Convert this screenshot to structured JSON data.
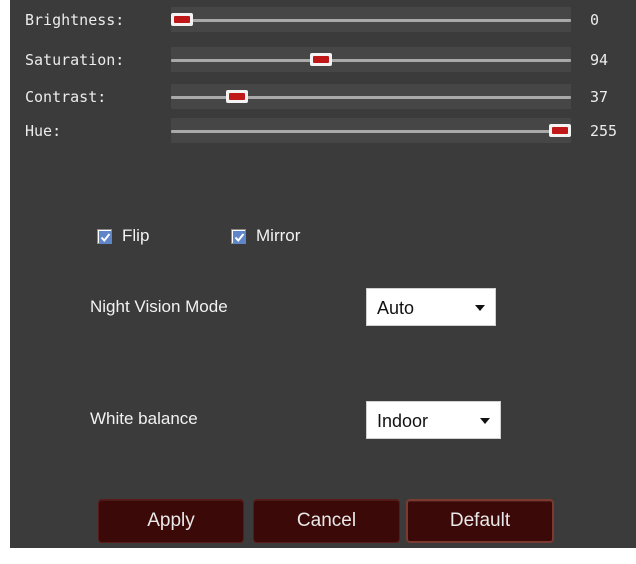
{
  "sliders": [
    {
      "label": "Brightness:",
      "value": "0",
      "level": 0
    },
    {
      "label": "Saturation:",
      "value": "94",
      "level": 94
    },
    {
      "label": "Contrast:",
      "value": "37",
      "level": 37
    },
    {
      "label": "Hue:",
      "value": "255",
      "level": 255
    }
  ],
  "slider_max": 255,
  "checkboxes": {
    "flip": {
      "label": "Flip",
      "checked": true
    },
    "mirror": {
      "label": "Mirror",
      "checked": true
    }
  },
  "night_vision": {
    "label": "Night Vision Mode",
    "selected": "Auto"
  },
  "white_balance": {
    "label": "White balance",
    "selected": "Indoor"
  },
  "buttons": {
    "apply": "Apply",
    "cancel": "Cancel",
    "default": "Default"
  },
  "colors": {
    "panel": "#3b3b3b",
    "thumb_accent": "#c01818",
    "button_bg": "#3b0a08"
  },
  "icons": {
    "check": "check-icon",
    "dropdown": "chevron-down-icon"
  }
}
